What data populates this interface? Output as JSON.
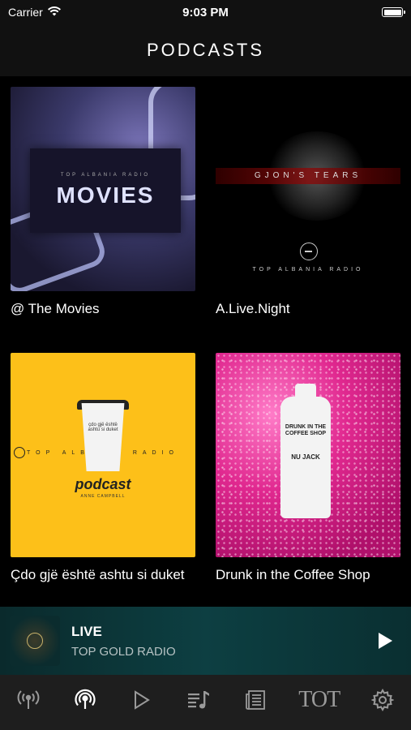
{
  "status_bar": {
    "carrier": "Carrier",
    "time": "9:03 PM"
  },
  "nav": {
    "title": "PODCASTS"
  },
  "podcasts": [
    {
      "title": "@ The Movies",
      "art": {
        "kind": "movies",
        "subtitle": "TOP ALBANIA RADIO",
        "word": "MOVIES"
      }
    },
    {
      "title": "A.Live.Night",
      "art": {
        "kind": "night",
        "band": "GJON'S TEARS",
        "brand": "TOP ALBANIA RADIO"
      }
    },
    {
      "title": "Çdo gjë është ashtu si duket",
      "art": {
        "kind": "cafe",
        "line": "TOP ALBANIA RADIO",
        "cup": "çdo gjë është ashtu si duket",
        "word": "podcast",
        "word_sub": "ANNE CAMPBELL"
      }
    },
    {
      "title": "Drunk in the Coffee Shop",
      "art": {
        "kind": "coffee",
        "label": "DRUNK IN THE COFFEE SHOP",
        "label2": "NU JACK"
      }
    }
  ],
  "now_playing": {
    "title": "LIVE",
    "subtitle": "TOP GOLD RADIO"
  },
  "tabs": [
    {
      "name": "tab-live",
      "icon": "antenna-icon"
    },
    {
      "name": "tab-podcasts",
      "icon": "podcast-icon",
      "active": true
    },
    {
      "name": "tab-play",
      "icon": "play-icon"
    },
    {
      "name": "tab-playlist",
      "icon": "playlist-icon"
    },
    {
      "name": "tab-news",
      "icon": "newspaper-icon"
    },
    {
      "name": "tab-tot",
      "icon": "tot-logo",
      "label": "TOT"
    },
    {
      "name": "tab-settings",
      "icon": "gear-icon"
    }
  ],
  "colors": {
    "background": "#000000",
    "bar": "#1e1e1e",
    "now_playing": "#0d3f42",
    "icon_inactive": "#9a9a9a",
    "icon_active": "#ffffff"
  }
}
